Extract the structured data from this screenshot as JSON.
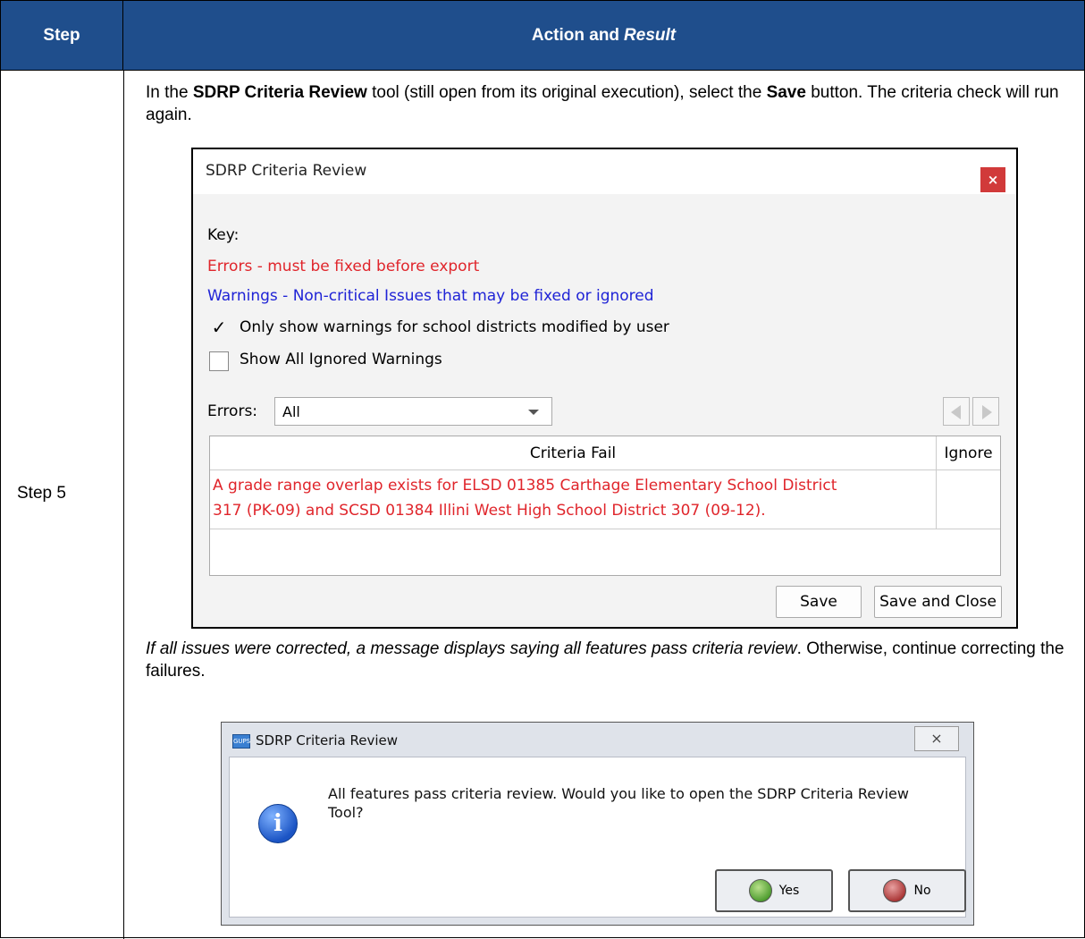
{
  "table": {
    "header_step": "Step",
    "header_action": "Action and",
    "header_result": "Result",
    "step_label": "Step 5",
    "para1_a": "In the ",
    "para1_b": "SDRP Criteria Review",
    "para1_c": " tool (still open from its original execution), select the ",
    "para1_d": "Save",
    "para1_e": " button. The criteria check will run again.",
    "para2_italic": "If all issues were corrected, a message displays saying all features pass criteria review",
    "para2_rest": ". Otherwise, continue correcting the failures."
  },
  "criteria_dialog": {
    "title": "SDRP Criteria Review",
    "close": "×",
    "key_label": "Key:",
    "errors_key": "Errors - must be fixed before export",
    "warnings_key": "Warnings - Non-critical Issues that may be fixed or ignored",
    "option1_label": "Only show warnings for school districts modified by user",
    "option1_checked": "✓",
    "option2_label": "Show All Ignored Warnings",
    "errors_filter_label": "Errors:",
    "errors_filter_value": "All",
    "col_criteria": "Criteria Fail",
    "col_ignore": "Ignore",
    "row1_line1": "A grade range overlap exists for ELSD 01385 Carthage Elementary School District",
    "row1_line2": "317 (PK-09) and SCSD 01384 Illini West High School District 307 (09-12).",
    "save_label": "Save",
    "save_close_label": "Save and Close",
    "colors": {
      "error": "#e0252b",
      "warning": "#1f23d6",
      "close_bg": "#d13a3a"
    }
  },
  "message_box": {
    "title": "SDRP Criteria Review",
    "app_icon_text": "GUPS",
    "close": "⨯",
    "message": "All features pass criteria review. Would you like to open the SDRP Criteria Review Tool?",
    "yes_label": "Yes",
    "no_label": "No",
    "icon": "info-icon"
  }
}
